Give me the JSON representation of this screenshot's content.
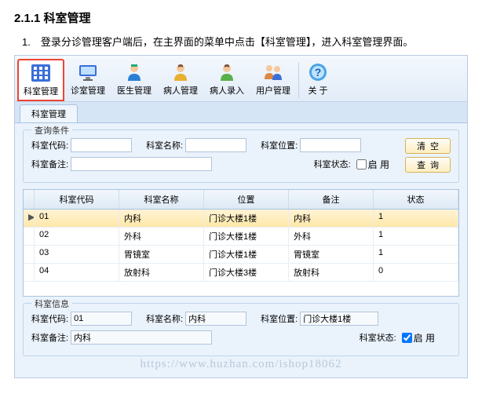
{
  "doc": {
    "title": "2.1.1 科室管理",
    "intro": "1.　登录分诊管理客户端后，在主界面的菜单中点击【科室管理】，进入科室管理界面。"
  },
  "toolbar": [
    {
      "label": "科室管理",
      "icon": "grid"
    },
    {
      "label": "诊室管理",
      "icon": "monitor"
    },
    {
      "label": "医生管理",
      "icon": "doctor"
    },
    {
      "label": "病人管理",
      "icon": "patient"
    },
    {
      "label": "病人录入",
      "icon": "patient2"
    },
    {
      "label": "用户管理",
      "icon": "users"
    },
    {
      "label": "关 于",
      "icon": "help"
    }
  ],
  "tab": "科室管理",
  "query": {
    "title": "查询条件",
    "code_label": "科室代码:",
    "code": "",
    "name_label": "科室名称:",
    "name": "",
    "loc_label": "科室位置:",
    "loc": "",
    "remark_label": "科室备注:",
    "remark": "",
    "status_label": "科室状态:",
    "status_cb": "启 用",
    "btn_clear": "清空",
    "btn_query": "查询"
  },
  "grid": {
    "headers": [
      "科室代码",
      "科室名称",
      "位置",
      "备注",
      "状态"
    ],
    "rows": [
      {
        "mark": "▶",
        "code": "01",
        "name": "内科",
        "loc": "门诊大楼1楼",
        "remark": "内科",
        "status": "1"
      },
      {
        "mark": "",
        "code": "02",
        "name": "外科",
        "loc": "门诊大楼1楼",
        "remark": "外科",
        "status": "1"
      },
      {
        "mark": "",
        "code": "03",
        "name": "胃镜室",
        "loc": "门诊大楼1楼",
        "remark": "胃镜室",
        "status": "1"
      },
      {
        "mark": "",
        "code": "04",
        "name": "放射科",
        "loc": "门诊大楼3楼",
        "remark": "放射科",
        "status": "0"
      }
    ]
  },
  "info": {
    "title": "科室信息",
    "code_label": "科室代码:",
    "code": "01",
    "name_label": "科室名称:",
    "name": "内科",
    "loc_label": "科室位置:",
    "loc": "门诊大楼1楼",
    "remark_label": "科室备注:",
    "remark": "内科",
    "status_label": "科室状态:",
    "status_cb": "启 用"
  },
  "watermark": "https://www.huzhan.com/ishop18062"
}
